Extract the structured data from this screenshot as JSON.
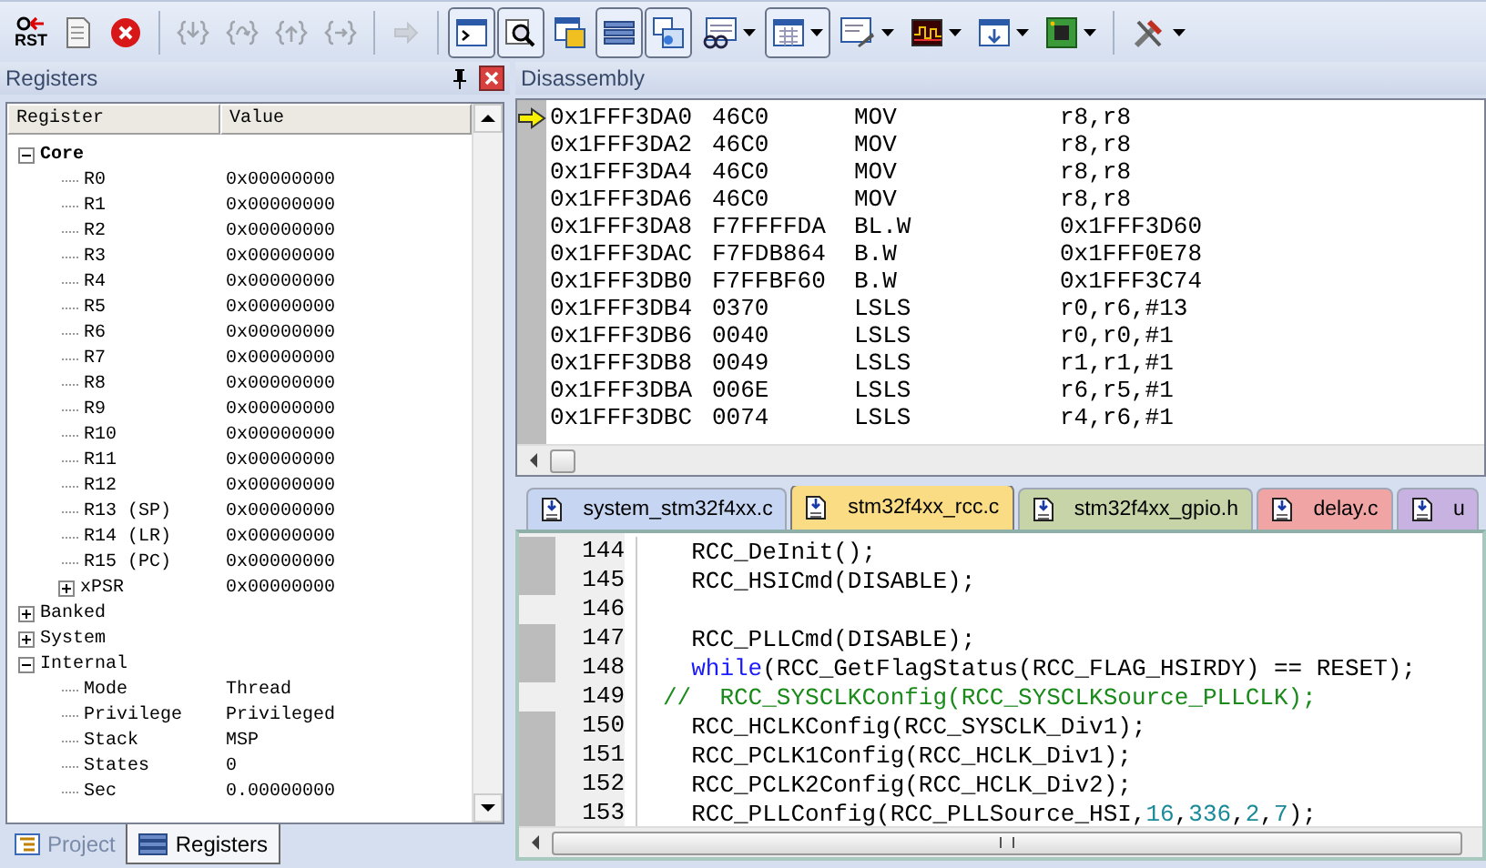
{
  "toolbar": {
    "groups": [
      [
        {
          "kind": "reset",
          "label": "RST",
          "disabled": false,
          "pressed": false,
          "dropdown": false
        },
        {
          "kind": "document",
          "disabled": false,
          "pressed": false,
          "dropdown": false
        },
        {
          "kind": "stop",
          "disabled": false,
          "pressed": false,
          "dropdown": false
        }
      ],
      [
        {
          "kind": "stepin",
          "disabled": true,
          "pressed": false,
          "dropdown": false
        },
        {
          "kind": "stepover",
          "disabled": true,
          "pressed": false,
          "dropdown": false
        },
        {
          "kind": "stepout",
          "disabled": true,
          "pressed": false,
          "dropdown": false
        },
        {
          "kind": "runto",
          "disabled": true,
          "pressed": false,
          "dropdown": false
        }
      ],
      [
        {
          "kind": "arrow",
          "disabled": true,
          "pressed": false,
          "dropdown": false
        }
      ],
      [
        {
          "kind": "console",
          "disabled": false,
          "pressed": true,
          "dropdown": false
        },
        {
          "kind": "disasm",
          "disabled": false,
          "pressed": true,
          "dropdown": false
        },
        {
          "kind": "symbols",
          "disabled": false,
          "pressed": false,
          "dropdown": false
        },
        {
          "kind": "registers",
          "disabled": false,
          "pressed": true,
          "dropdown": false
        },
        {
          "kind": "windows",
          "disabled": false,
          "pressed": true,
          "dropdown": false
        },
        {
          "kind": "watch",
          "disabled": false,
          "pressed": false,
          "dropdown": true
        },
        {
          "kind": "memory",
          "disabled": false,
          "pressed": true,
          "dropdown": true
        },
        {
          "kind": "serial",
          "disabled": false,
          "pressed": false,
          "dropdown": true
        },
        {
          "kind": "analyzer",
          "disabled": false,
          "pressed": false,
          "dropdown": true
        },
        {
          "kind": "trace",
          "disabled": false,
          "pressed": false,
          "dropdown": true
        },
        {
          "kind": "viewer",
          "disabled": false,
          "pressed": false,
          "dropdown": true
        }
      ],
      [
        {
          "kind": "tools",
          "disabled": false,
          "pressed": false,
          "dropdown": true
        }
      ]
    ]
  },
  "registers_panel": {
    "title": "Registers",
    "columns": [
      "Register",
      "Value"
    ],
    "tree": [
      {
        "name": "Core",
        "bold": true,
        "expanded": true,
        "children": [
          {
            "name": "R0",
            "value": "0x00000000"
          },
          {
            "name": "R1",
            "value": "0x00000000"
          },
          {
            "name": "R2",
            "value": "0x00000000"
          },
          {
            "name": "R3",
            "value": "0x00000000"
          },
          {
            "name": "R4",
            "value": "0x00000000"
          },
          {
            "name": "R5",
            "value": "0x00000000"
          },
          {
            "name": "R6",
            "value": "0x00000000"
          },
          {
            "name": "R7",
            "value": "0x00000000"
          },
          {
            "name": "R8",
            "value": "0x00000000"
          },
          {
            "name": "R9",
            "value": "0x00000000"
          },
          {
            "name": "R10",
            "value": "0x00000000"
          },
          {
            "name": "R11",
            "value": "0x00000000"
          },
          {
            "name": "R12",
            "value": "0x00000000"
          },
          {
            "name": "R13 (SP)",
            "value": "0x00000000"
          },
          {
            "name": "R14 (LR)",
            "value": "0x00000000"
          },
          {
            "name": "R15 (PC)",
            "value": "0x00000000"
          },
          {
            "name": "xPSR",
            "value": "0x00000000",
            "expanded": false
          }
        ]
      },
      {
        "name": "Banked",
        "expanded": false
      },
      {
        "name": "System",
        "expanded": false
      },
      {
        "name": "Internal",
        "expanded": true,
        "children": [
          {
            "name": "Mode",
            "value": "Thread"
          },
          {
            "name": "Privilege",
            "value": "Privileged"
          },
          {
            "name": "Stack",
            "value": "MSP"
          },
          {
            "name": "States",
            "value": "0"
          },
          {
            "name": "Sec",
            "value": "0.00000000"
          }
        ]
      }
    ],
    "tabs": [
      {
        "label": "Project",
        "selected": false
      },
      {
        "label": "Registers",
        "selected": true
      }
    ]
  },
  "disassembly": {
    "title": "Disassembly",
    "rows": [
      {
        "address": "0x1FFF3DA0",
        "opcode": "46C0",
        "mnemonic": "MOV",
        "operands": "r8,r8",
        "current": true
      },
      {
        "address": "0x1FFF3DA2",
        "opcode": "46C0",
        "mnemonic": "MOV",
        "operands": "r8,r8",
        "current": false
      },
      {
        "address": "0x1FFF3DA4",
        "opcode": "46C0",
        "mnemonic": "MOV",
        "operands": "r8,r8",
        "current": false
      },
      {
        "address": "0x1FFF3DA6",
        "opcode": "46C0",
        "mnemonic": "MOV",
        "operands": "r8,r8",
        "current": false
      },
      {
        "address": "0x1FFF3DA8",
        "opcode": "F7FFFFDA",
        "mnemonic": "BL.W",
        "operands": "0x1FFF3D60",
        "current": false
      },
      {
        "address": "0x1FFF3DAC",
        "opcode": "F7FDB864",
        "mnemonic": "B.W",
        "operands": "0x1FFF0E78",
        "current": false
      },
      {
        "address": "0x1FFF3DB0",
        "opcode": "F7FFBF60",
        "mnemonic": "B.W",
        "operands": "0x1FFF3C74",
        "current": false
      },
      {
        "address": "0x1FFF3DB4",
        "opcode": "0370",
        "mnemonic": "LSLS",
        "operands": "r0,r6,#13",
        "current": false
      },
      {
        "address": "0x1FFF3DB6",
        "opcode": "0040",
        "mnemonic": "LSLS",
        "operands": "r0,r0,#1",
        "current": false
      },
      {
        "address": "0x1FFF3DB8",
        "opcode": "0049",
        "mnemonic": "LSLS",
        "operands": "r1,r1,#1",
        "current": false
      },
      {
        "address": "0x1FFF3DBA",
        "opcode": "006E",
        "mnemonic": "LSLS",
        "operands": "r6,r5,#1",
        "current": false
      },
      {
        "address": "0x1FFF3DBC",
        "opcode": "0074",
        "mnemonic": "LSLS",
        "operands": "r4,r6,#1",
        "current": false
      }
    ]
  },
  "editor": {
    "tabs": [
      {
        "label": "system_stm32f4xx.c",
        "color": "#c6d6f2",
        "selected": false
      },
      {
        "label": "stm32f4xx_rcc.c",
        "color": "#fadc84",
        "selected": true
      },
      {
        "label": "stm32f4xx_gpio.h",
        "color": "#c6d4a8",
        "selected": false
      },
      {
        "label": "delay.c",
        "color": "#f0a4a4",
        "selected": false
      },
      {
        "label": "u",
        "color": "#c8b2e2",
        "selected": false
      }
    ],
    "lines": [
      {
        "number": "144",
        "executable": true,
        "segments": [
          {
            "kind": "plain",
            "text": "  RCC_DeInit();"
          }
        ]
      },
      {
        "number": "145",
        "executable": true,
        "segments": [
          {
            "kind": "plain",
            "text": "  RCC_HSICmd(DISABLE);"
          }
        ]
      },
      {
        "number": "146",
        "executable": false
      },
      {
        "number": "147",
        "executable": true,
        "segments": [
          {
            "kind": "plain",
            "text": "  RCC_PLLCmd(DISABLE);"
          }
        ]
      },
      {
        "number": "148",
        "executable": true,
        "segments": [
          {
            "kind": "keyword",
            "text": "  while"
          },
          {
            "kind": "plain",
            "text": "(RCC_GetFlagStatus(RCC_FLAG_HSIRDY) == RESET);"
          }
        ]
      },
      {
        "number": "149",
        "executable": false,
        "segments": [
          {
            "kind": "comment",
            "text": "//  RCC_SYSCLKConfig(RCC_SYSCLKSource_PLLCLK);"
          }
        ]
      },
      {
        "number": "150",
        "executable": true,
        "segments": [
          {
            "kind": "plain",
            "text": "  RCC_HCLKConfig(RCC_SYSCLK_Div1);"
          }
        ]
      },
      {
        "number": "151",
        "executable": true,
        "segments": [
          {
            "kind": "plain",
            "text": "  RCC_PCLK1Config(RCC_HCLK_Div1);"
          }
        ]
      },
      {
        "number": "152",
        "executable": true,
        "segments": [
          {
            "kind": "plain",
            "text": "  RCC_PCLK2Config(RCC_HCLK_Div2);"
          }
        ]
      },
      {
        "number": "153",
        "executable": true,
        "segments": [
          {
            "kind": "plain",
            "text": "  RCC_PLLConfig(RCC_PLLSource_HSI,"
          },
          {
            "kind": "number",
            "text": "16"
          },
          {
            "kind": "plain",
            "text": ","
          },
          {
            "kind": "number",
            "text": "336"
          },
          {
            "kind": "plain",
            "text": ","
          },
          {
            "kind": "number",
            "text": "2"
          },
          {
            "kind": "plain",
            "text": ","
          },
          {
            "kind": "number",
            "text": "7"
          },
          {
            "kind": "plain",
            "text": ");"
          }
        ]
      }
    ]
  }
}
